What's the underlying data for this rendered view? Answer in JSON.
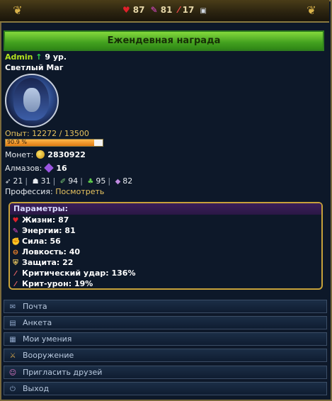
{
  "topbar": {
    "hp": "87",
    "energy": "81",
    "attack": "17",
    "icons": {
      "hp": "heart-icon",
      "energy": "energy-pen-icon",
      "attack": "sword-icon",
      "messages": "message-icon"
    }
  },
  "daily_reward": {
    "label": "Ежендевная награда"
  },
  "profile": {
    "name": "Admin",
    "level": "9 ур.",
    "class": "Светлый Маг",
    "exp_text": "Опыт: 12272 / 13500",
    "exp_percent_text": "90.9 %",
    "exp_fraction": 0.909
  },
  "currency": {
    "coins_label": "Монет:",
    "coins_value": "2830922",
    "diamonds_label": "Алмазов:",
    "diamonds_value": "16"
  },
  "resources": [
    {
      "icon": "wood-icon",
      "value": "21"
    },
    {
      "icon": "stone-icon",
      "value": "31"
    },
    {
      "icon": "ore-icon",
      "value": "94"
    },
    {
      "icon": "herb-icon",
      "value": "95"
    },
    {
      "icon": "crystal-icon",
      "value": "82"
    }
  ],
  "profession": {
    "label": "Профессия:",
    "link": "Посмотреть"
  },
  "params": {
    "title": "Параметры:",
    "rows": [
      {
        "icon": "heart-icon",
        "label": "Жизни:",
        "value": "87"
      },
      {
        "icon": "energy-icon",
        "label": "Энергии:",
        "value": "81"
      },
      {
        "icon": "strength-icon",
        "label": "Сила:",
        "value": "56"
      },
      {
        "icon": "agility-icon",
        "label": "Ловкость:",
        "value": "40"
      },
      {
        "icon": "shield-icon",
        "label": "Защита:",
        "value": "22"
      },
      {
        "icon": "crit-icon",
        "label": "Критический удар:",
        "value": "136%"
      },
      {
        "icon": "crit-damage-icon",
        "label": "Крит-урон:",
        "value": "19%"
      }
    ]
  },
  "menu": [
    {
      "icon": "mail-icon",
      "label": "Почта"
    },
    {
      "icon": "profile-card-icon",
      "label": "Анкета"
    },
    {
      "icon": "skills-icon",
      "label": "Мои умения"
    },
    {
      "icon": "armor-icon",
      "label": "Вооружение"
    },
    {
      "icon": "invite-icon",
      "label": "Пригласить друзей"
    },
    {
      "icon": "logout-icon",
      "label": "Выход"
    }
  ]
}
